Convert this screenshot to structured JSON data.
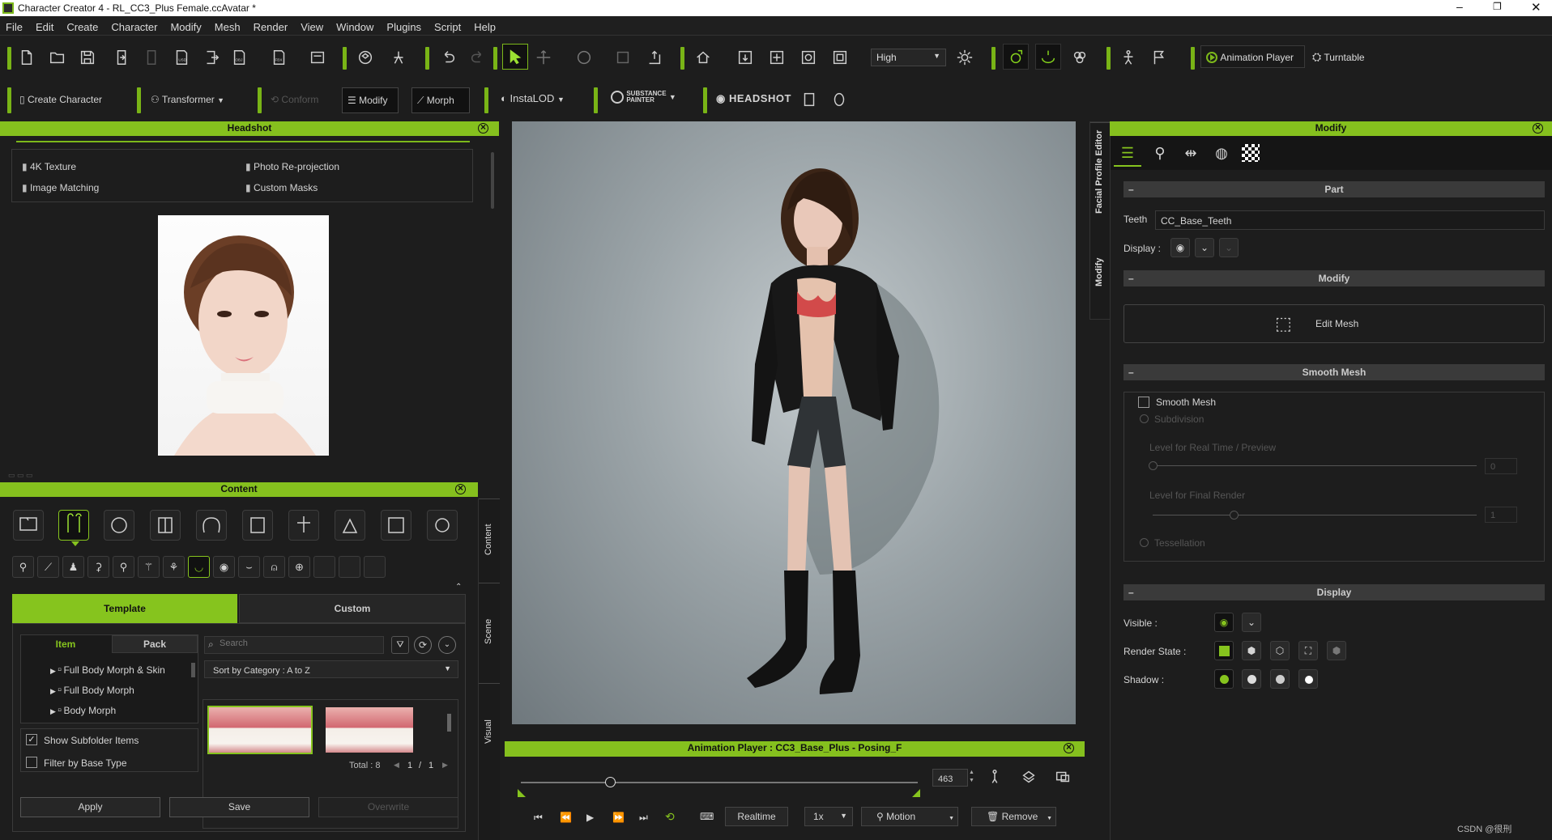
{
  "window": {
    "title": "Character Creator 4 - RL_CC3_Plus Female.ccAvatar *"
  },
  "menu": [
    "File",
    "Edit",
    "Create",
    "Character",
    "Modify",
    "Mesh",
    "Render",
    "View",
    "Window",
    "Plugins",
    "Script",
    "Help"
  ],
  "toolbar1": {
    "quality": "High",
    "animation_player": "Animation Player",
    "turntable": "Turntable"
  },
  "toolbar2": {
    "create_character": "Create Character",
    "transformer": "Transformer",
    "conform": "Conform",
    "modify": "Modify",
    "morph": "Morph",
    "instalod": "InstaLOD",
    "substance_line1": "SUBSTANCE",
    "substance_line2": "PAINTER",
    "headshot": "HEADSHOT"
  },
  "headshot": {
    "title": "Headshot",
    "features": [
      "4K Texture",
      "Photo Re-projection",
      "Image Matching",
      "Custom Masks"
    ]
  },
  "content": {
    "title": "Content",
    "tabs": {
      "template": "Template",
      "custom": "Custom"
    },
    "subtabs": {
      "item": "Item",
      "pack": "Pack"
    },
    "search_placeholder": "Search",
    "sort": "Sort by Category : A to Z",
    "tree": [
      "Full Body Morph & Skin",
      "Full Body Morph",
      "Body Morph"
    ],
    "show_subfolder": "Show Subfolder Items",
    "filter_base": "Filter by Base Type",
    "total_label": "Total : 8",
    "page": "1",
    "page_total": "1",
    "buttons": {
      "apply": "Apply",
      "save": "Save",
      "overwrite": "Overwrite"
    },
    "side_tabs": [
      "Content",
      "Scene",
      "Visual"
    ]
  },
  "viewport_tabs": [
    "Facial Profile Editor",
    "Modify"
  ],
  "anim": {
    "title": "Animation Player : CC3_Base_Plus - Posing_F",
    "frame": "463",
    "realtime": "Realtime",
    "speed": "1x",
    "motion": "Motion",
    "remove": "Remove",
    "progress": 0.225
  },
  "modify": {
    "title": "Modify",
    "part_header": "Part",
    "part_label": "Teeth",
    "part_value": "CC_Base_Teeth",
    "display_label": "Display :",
    "modify_header": "Modify",
    "edit_mesh": "Edit Mesh",
    "smooth_header": "Smooth Mesh",
    "smooth_mesh": "Smooth Mesh",
    "subdivision": "Subdivision",
    "level_rt": "Level for Real Time / Preview",
    "level_rt_val": "0",
    "level_final": "Level for Final Render",
    "level_final_val": "1",
    "tessellation": "Tessellation",
    "display_header": "Display",
    "visible": "Visible :",
    "render_state": "Render State :",
    "shadow": "Shadow :"
  },
  "watermark": "CSDN @很刑",
  "colors": {
    "accent": "#85c01e",
    "panel": "#1d1d1d"
  }
}
